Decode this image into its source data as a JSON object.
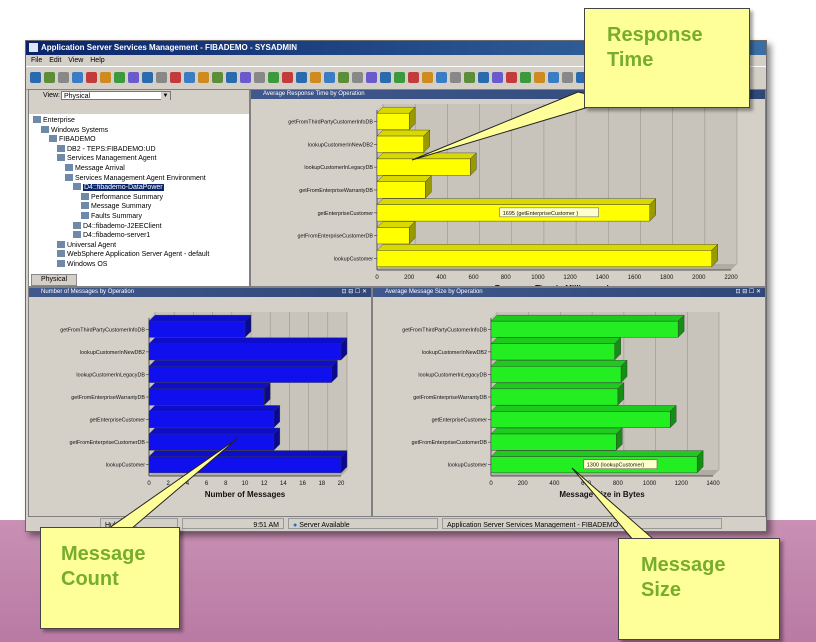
{
  "app": {
    "title": "Application Server Services Management - FIBADEMO - SYSADMIN",
    "menu": [
      "File",
      "Edit",
      "View",
      "Help"
    ]
  },
  "navigator": {
    "view_label": "View:",
    "view_value": "Physical",
    "tab_label": "Physical",
    "tree": [
      {
        "label": "Enterprise",
        "level": 0,
        "selected": false
      },
      {
        "label": "Windows Systems",
        "level": 1,
        "selected": false
      },
      {
        "label": "FIBADEMO",
        "level": 2,
        "selected": false
      },
      {
        "label": "DB2 - TEPS:FIBADEMO:UD",
        "level": 3,
        "selected": false
      },
      {
        "label": "Services Management Agent",
        "level": 3,
        "selected": false
      },
      {
        "label": "Message Arrival",
        "level": 4,
        "selected": false
      },
      {
        "label": "Services Management Agent Environment",
        "level": 4,
        "selected": false
      },
      {
        "label": "D4::fibademo-DataPower",
        "level": 5,
        "selected": true
      },
      {
        "label": "Performance Summary",
        "level": 6,
        "selected": false
      },
      {
        "label": "Message Summary",
        "level": 6,
        "selected": false
      },
      {
        "label": "Faults Summary",
        "level": 6,
        "selected": false
      },
      {
        "label": "D4::fibademo-J2EEClient",
        "level": 5,
        "selected": false
      },
      {
        "label": "D4::fibademo-server1",
        "level": 5,
        "selected": false
      },
      {
        "label": "Universal Agent",
        "level": 3,
        "selected": false
      },
      {
        "label": "WebSphere Application Server Agent - default",
        "level": 3,
        "selected": false
      },
      {
        "label": "Windows OS",
        "level": 3,
        "selected": false
      }
    ]
  },
  "status": {
    "hub_time": "Hub Time: ",
    "clock": "9:51 AM",
    "server": "Server Available",
    "window_title": "Application Server Services Management - FIBADEMO"
  },
  "panels": {
    "response": {
      "title": "Average Response Time by Operation"
    },
    "count": {
      "title": "Number of Messages by Operation"
    },
    "size": {
      "title": "Average Message Size by Operation"
    }
  },
  "callouts": {
    "response": [
      "Response",
      "Time"
    ],
    "count": [
      "Message",
      "Count"
    ],
    "size": [
      "Message",
      "Size"
    ]
  },
  "chart_data": [
    {
      "type": "bar",
      "orientation": "horizontal",
      "title": "Average Response Time by Operation",
      "categories": [
        "getFromThirdPartyCustomerInfoDB",
        "lookupCustomerInNewDB2",
        "lookupCustomerInLegacyDB",
        "getFromEnterpriseWarrantyDB",
        "getEnterpriseCustomer",
        "getFromEnterpriseCustomerDB",
        "lookupCustomer"
      ],
      "values": [
        200,
        290,
        580,
        300,
        1695,
        200,
        2080
      ],
      "xlabel": "Response Time in Milliseconds",
      "xlim": [
        0,
        2200
      ],
      "ticks": [
        0,
        200,
        400,
        600,
        800,
        1000,
        1200,
        1400,
        1600,
        1800,
        2000,
        2200
      ],
      "color": "#ffff00",
      "annotation": "1695 (getEnterpriseCustomer )",
      "annotation_index": 4
    },
    {
      "type": "bar",
      "orientation": "horizontal",
      "title": "Number of Messages by Operation",
      "categories": [
        "getFromThirdPartyCustomerInfoDB",
        "lookupCustomerInNewDB2",
        "lookupCustomerInLegacyDB",
        "getFromEnterpriseWarrantyDB",
        "getEnterpriseCustomer",
        "getFromEnterpriseCustomerDB",
        "lookupCustomer"
      ],
      "values": [
        10,
        20,
        19,
        12,
        13,
        13,
        20
      ],
      "xlabel": "Number of Messages",
      "xlim": [
        0,
        20
      ],
      "ticks": [
        0,
        2,
        4,
        6,
        8,
        10,
        12,
        14,
        16,
        18,
        20
      ],
      "color": "#1010ee"
    },
    {
      "type": "bar",
      "orientation": "horizontal",
      "title": "Average Message Size by Operation",
      "categories": [
        "getFromThirdPartyCustomerInfoDB",
        "lookupCustomerInNewDB2",
        "lookupCustomerInLegacyDB",
        "getFromEnterpriseWarrantyDB",
        "getEnterpriseCustomer",
        "getFromEnterpriseCustomerDB",
        "lookupCustomer"
      ],
      "values": [
        1180,
        780,
        820,
        800,
        1130,
        790,
        1300
      ],
      "xlabel": "Message Size in Bytes",
      "xlim": [
        0,
        1400
      ],
      "ticks": [
        0,
        200,
        400,
        600,
        800,
        1000,
        1200,
        1400
      ],
      "color": "#22ee22",
      "annotation": "1300 (lookupCustomer)",
      "annotation_index": 6
    }
  ]
}
